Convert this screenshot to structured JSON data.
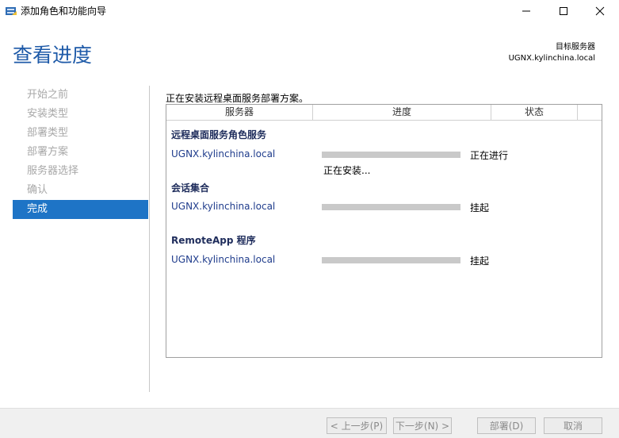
{
  "window": {
    "title": "添加角色和功能向导"
  },
  "header": {
    "page_title": "查看进度",
    "dest_label": "目标服务器",
    "dest_server": "UGNX.kylinchina.local"
  },
  "nav": {
    "items": [
      {
        "label": "开始之前"
      },
      {
        "label": "安装类型"
      },
      {
        "label": "部署类型"
      },
      {
        "label": "部署方案"
      },
      {
        "label": "服务器选择"
      },
      {
        "label": "确认"
      },
      {
        "label": "完成",
        "active": true
      }
    ]
  },
  "content": {
    "status_text": "正在安装远程桌面服务部署方案。",
    "columns": {
      "server": "服务器",
      "progress": "进度",
      "status": "状态"
    },
    "groups": [
      {
        "title": "远程桌面服务角色服务",
        "server": "UGNX.kylinchina.local",
        "progress": 0,
        "status": "正在进行",
        "substatus": "正在安装..."
      },
      {
        "title": "会话集合",
        "server": "UGNX.kylinchina.local",
        "progress": 0,
        "status": "挂起"
      },
      {
        "title": "RemoteApp 程序",
        "server": "UGNX.kylinchina.local",
        "progress": 0,
        "status": "挂起"
      }
    ]
  },
  "footer": {
    "prev": "< 上一步(P)",
    "next": "下一步(N) >",
    "deploy": "部署(D)",
    "cancel": "取消"
  },
  "colors": {
    "title_blue": "#1e5aa8",
    "nav_active": "#1e74c6",
    "group_title": "#1f2d5c",
    "server_link": "#1f3c8c",
    "bar_track": "#c9c9c9"
  }
}
